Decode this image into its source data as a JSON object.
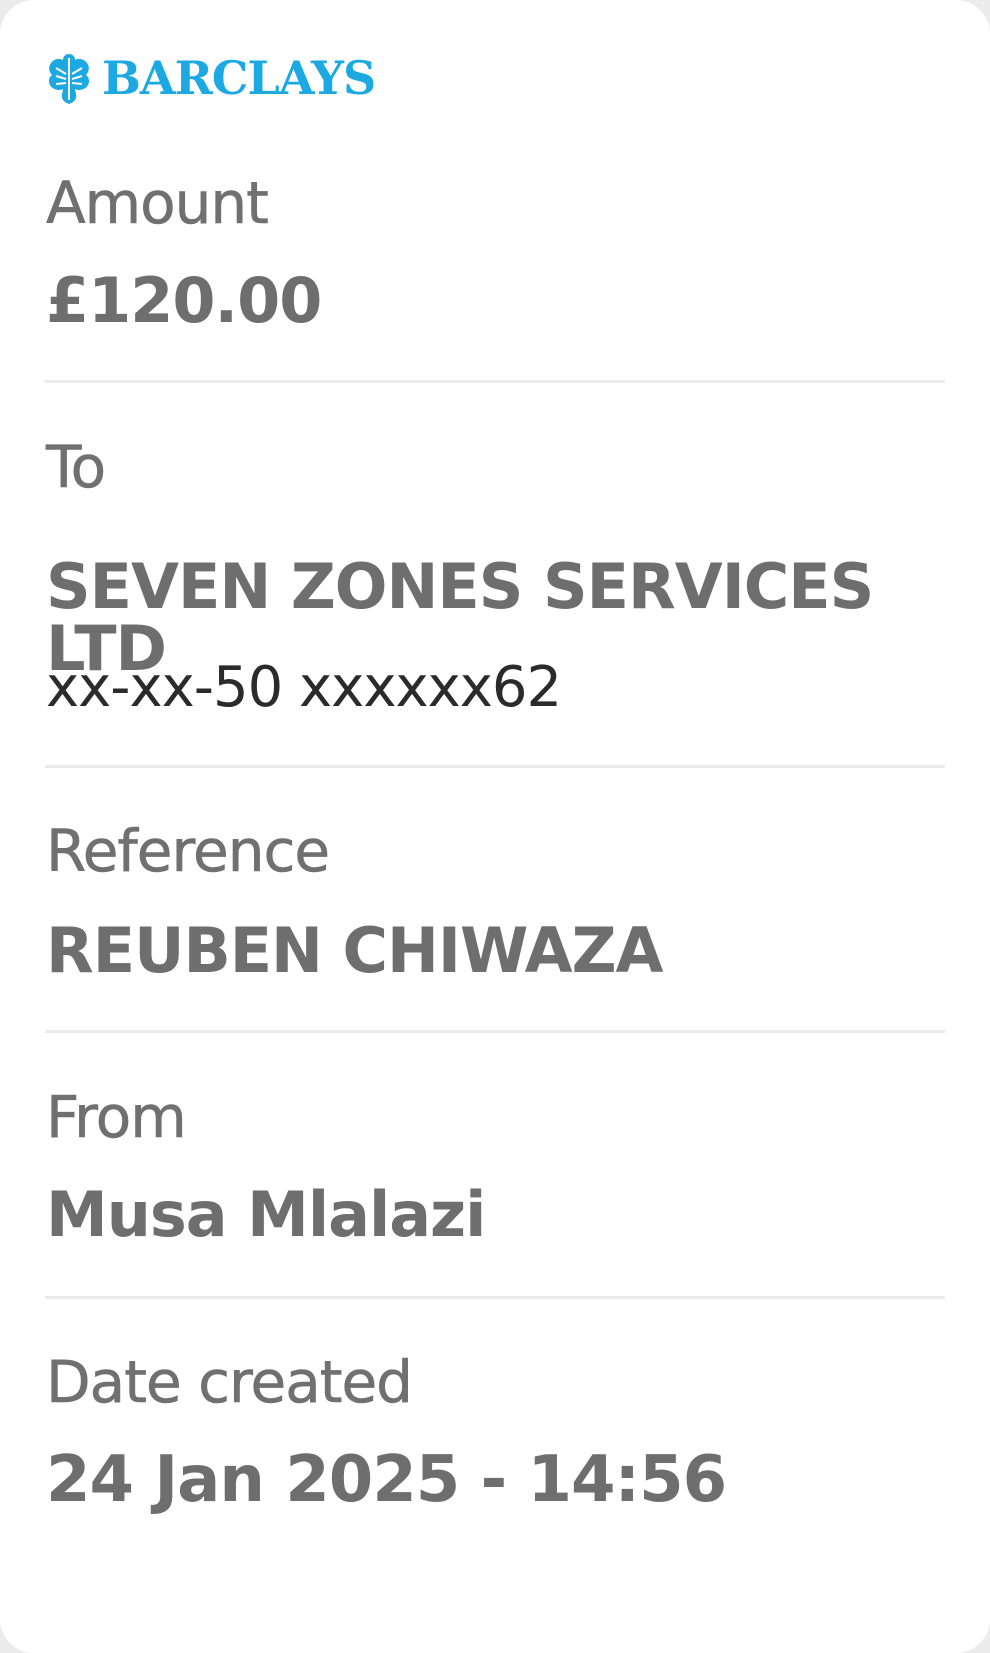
{
  "logo": {
    "wordmark": "BARCLAYS",
    "icon": "eagle-icon",
    "brand_color": "#1ca9e1"
  },
  "amount": {
    "label": "Amount",
    "value": "£120.00"
  },
  "to": {
    "label": "To",
    "name": "SEVEN ZONES SERVICES LTD",
    "account": "xx-xx-50 xxxxxx62"
  },
  "reference": {
    "label": "Reference",
    "value": "REUBEN CHIWAZA"
  },
  "from": {
    "label": "From",
    "value": "Musa Mlalazi"
  },
  "date_created": {
    "label": "Date created",
    "value": "24 Jan 2025 - 14:56"
  },
  "colors": {
    "text_grey": "#707070",
    "account_dark": "#2b2b2b",
    "divider": "#ebebeb",
    "background": "#ffffff"
  }
}
